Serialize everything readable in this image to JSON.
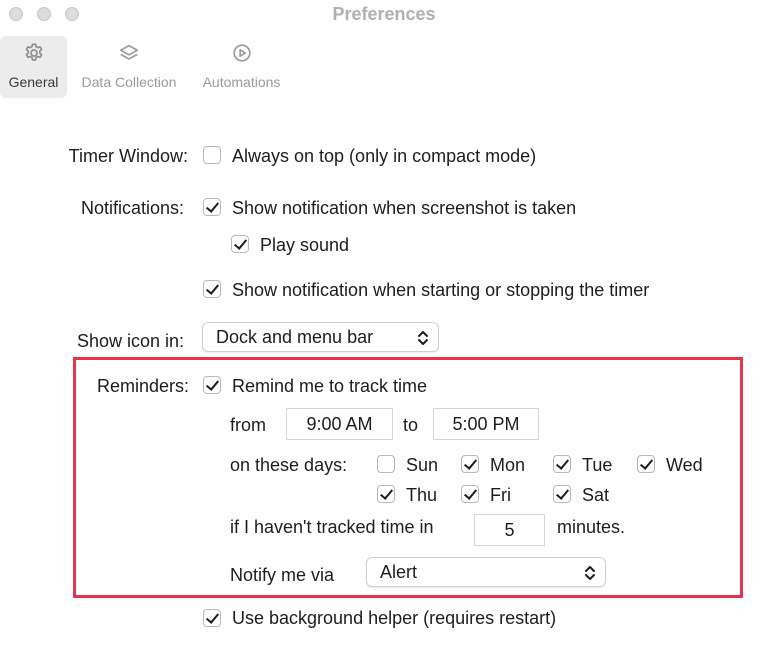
{
  "window": {
    "title": "Preferences"
  },
  "toolbar": {
    "items": [
      {
        "label": "General",
        "icon": "gear-icon",
        "active": true
      },
      {
        "label": "Data Collection",
        "icon": "layers-icon",
        "active": false
      },
      {
        "label": "Automations",
        "icon": "play-circle-icon",
        "active": false
      }
    ]
  },
  "general": {
    "timer_window": {
      "label": "Timer Window:",
      "always_on_top": {
        "label": "Always on top (only in compact mode)",
        "checked": false
      }
    },
    "notifications": {
      "label": "Notifications:",
      "screenshot": {
        "label": "Show notification when screenshot is taken",
        "checked": true
      },
      "play_sound": {
        "label": "Play sound",
        "checked": true
      },
      "timer": {
        "label": "Show notification when starting or stopping the timer",
        "checked": true
      }
    },
    "show_icon": {
      "label": "Show icon in:",
      "value": "Dock and menu bar"
    },
    "reminders": {
      "label": "Reminders:",
      "remind": {
        "label": "Remind me to track time",
        "checked": true
      },
      "from_label": "from",
      "from_value": "9:00 AM",
      "to_label": "to",
      "to_value": "5:00 PM",
      "days_label": "on these days:",
      "days": [
        {
          "label": "Sun",
          "checked": false
        },
        {
          "label": "Mon",
          "checked": true
        },
        {
          "label": "Tue",
          "checked": true
        },
        {
          "label": "Wed",
          "checked": true
        },
        {
          "label": "Thu",
          "checked": true
        },
        {
          "label": "Fri",
          "checked": true
        },
        {
          "label": "Sat",
          "checked": true
        }
      ],
      "idle_label": "if I haven't tracked time in",
      "idle_value": "5",
      "idle_unit": "minutes.",
      "notify_label": "Notify me via",
      "notify_value": "Alert"
    },
    "background_helper": {
      "label": "Use background helper (requires restart)",
      "checked": true
    }
  },
  "colors": {
    "highlight": "#e4334a"
  }
}
